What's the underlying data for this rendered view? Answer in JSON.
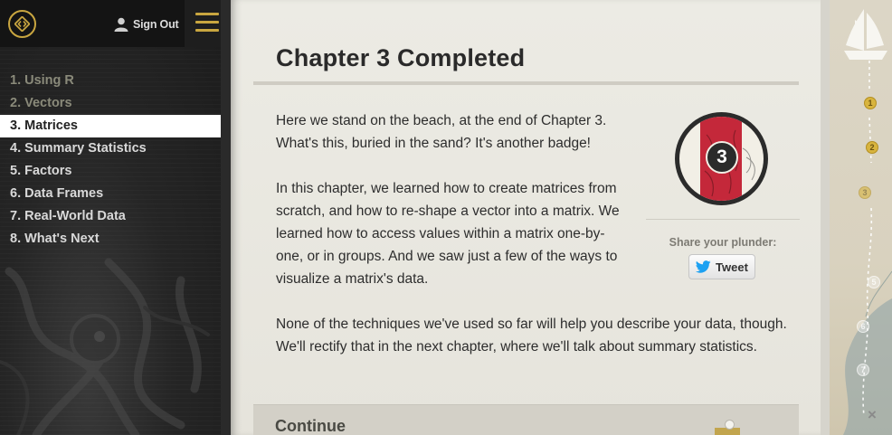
{
  "auth": {
    "signout_label": "Sign Out"
  },
  "chapters": [
    {
      "label": "1. Using R",
      "state": "done"
    },
    {
      "label": "2. Vectors",
      "state": "done"
    },
    {
      "label": "3. Matrices",
      "state": "active"
    },
    {
      "label": "4. Summary Statistics",
      "state": "todo"
    },
    {
      "label": "5. Factors",
      "state": "todo"
    },
    {
      "label": "6. Data Frames",
      "state": "todo"
    },
    {
      "label": "7. Real-World Data",
      "state": "todo"
    },
    {
      "label": "8. What's Next",
      "state": "todo"
    }
  ],
  "main": {
    "title": "Chapter 3 Completed",
    "paragraphs": [
      "Here we stand on the beach, at the end of Chapter 3. What's this, buried in the sand? It's another badge!",
      "In this chapter, we learned how to create matrices from scratch, and how to re-shape a vector into a matrix. We learned how to access values within a matrix one-by-one, or in groups. And we saw just a few of the ways to visualize a matrix's data.",
      "None of the techniques we've used so far will help you describe your data, though. We'll rectify that in the next chapter, where we'll talk about summary statistics."
    ],
    "badge_number": "3",
    "share_label": "Share your plunder:",
    "tweet_label": "Tweet",
    "continue_label": "Continue"
  },
  "map": {
    "markers": [
      "1",
      "2",
      "3",
      "5",
      "6",
      "7"
    ],
    "close_icon": "×"
  },
  "icons": {
    "logo": "code-brackets-icon",
    "user": "user-icon",
    "menu": "hamburger-icon",
    "twitter": "twitter-bird-icon",
    "ship": "ship-icon"
  },
  "colors": {
    "accent_gold": "#c9a640",
    "badge_red": "#c4283a",
    "sidebar_dark": "#1c1c1c",
    "parchment": "#ecebe4",
    "twitter_blue": "#1da1f2"
  }
}
